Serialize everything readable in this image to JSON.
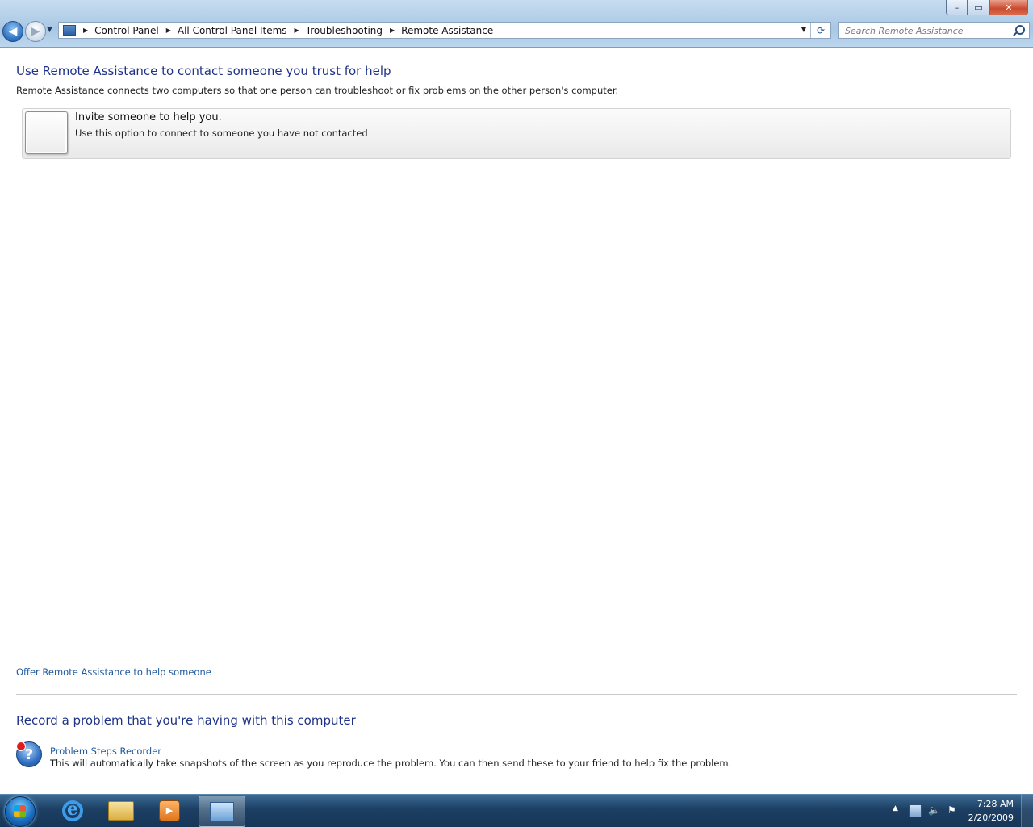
{
  "window": {
    "controls": {
      "minimize": "–",
      "maximize": "▭",
      "close": "✕"
    }
  },
  "nav": {
    "back_glyph": "◀",
    "forward_glyph": "▶",
    "recent_glyph": "▼"
  },
  "address": {
    "breadcrumbs": [
      "Control Panel",
      "All Control Panel Items",
      "Troubleshooting",
      "Remote Assistance"
    ],
    "separator": "▶",
    "dropdown_glyph": "▼",
    "refresh_glyph": "⟳"
  },
  "search": {
    "placeholder": "Search Remote Assistance"
  },
  "main": {
    "heading": "Use Remote Assistance to contact someone you trust for help",
    "intro": "Remote Assistance connects two computers so that one person can troubleshoot or fix problems on the other person's computer.",
    "option": {
      "title": "Invite someone to help you.",
      "description": "Use this option to connect to someone you have not contacted"
    },
    "offer_link": "Offer Remote Assistance to help someone",
    "record_heading": "Record a problem that you're having with this computer",
    "psr": {
      "icon_glyph": "?",
      "title": "Problem Steps Recorder",
      "description": "This will automatically take snapshots of the screen as you reproduce the problem. You can then send these to your friend to help fix the problem."
    }
  },
  "taskbar": {
    "media_glyph": "▶",
    "tray": {
      "arrow": "▲",
      "volume": "🔈",
      "flag": "⚑",
      "time": "7:28 AM",
      "date": "2/20/2009"
    }
  },
  "colors": {
    "heading": "#1e3287",
    "link": "#1f5a9d",
    "taskbar": "#1c3f63"
  }
}
